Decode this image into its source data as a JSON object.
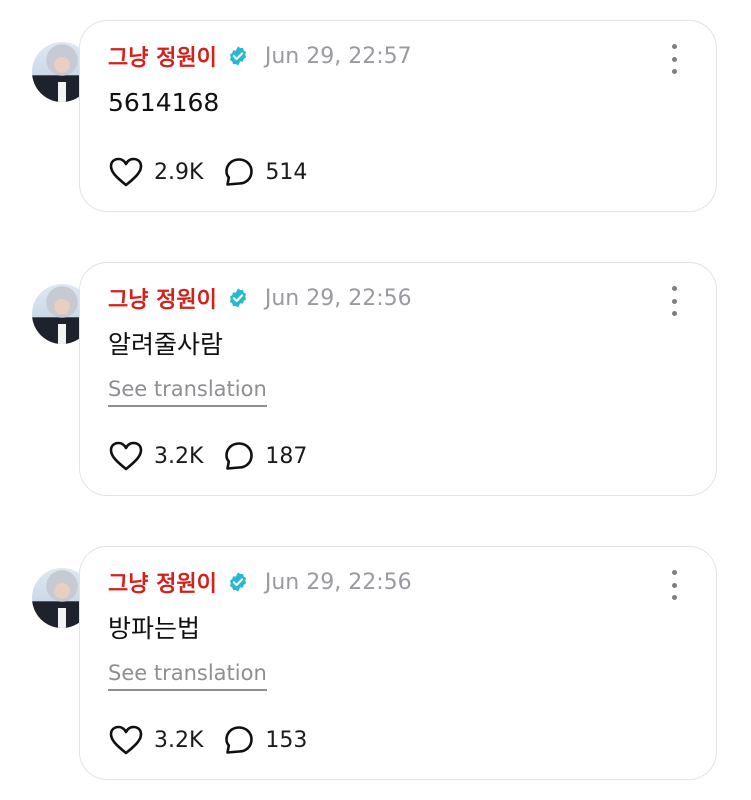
{
  "posts": [
    {
      "author": "그냥 정원이",
      "time": "Jun 29, 22:57",
      "text": "5614168",
      "see_translation": "",
      "likes": "2.9K",
      "comments": "514"
    },
    {
      "author": "그냥 정원이",
      "time": "Jun 29, 22:56",
      "text": "알려줄사람",
      "see_translation": "See translation",
      "likes": "3.2K",
      "comments": "187"
    },
    {
      "author": "그냥 정원이",
      "time": "Jun 29, 22:56",
      "text": "방파는법",
      "see_translation": "See translation",
      "likes": "3.2K",
      "comments": "153"
    }
  ],
  "icons": {
    "verified": "verified-badge-icon",
    "like": "heart-icon",
    "comment": "speech-bubble-icon",
    "more": "more-vertical-icon"
  },
  "colors": {
    "author": "#d3221b",
    "verified": "#27b9d0",
    "timestamp": "#9a9aa0",
    "card_border": "#e3e3e6"
  }
}
